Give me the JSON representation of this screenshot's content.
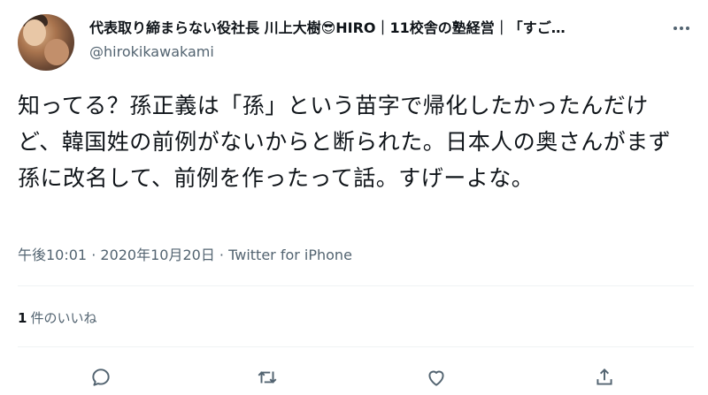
{
  "author": {
    "display_name": "代表取り締まらない役社長 川上大樹😎HIRO｜11校舎の塾経営｜「すご…",
    "handle": "@hirokikawakami"
  },
  "tweet": {
    "text": "知ってる？孫正義は「孫」という苗字で帰化したかったんだけど、韓国姓の前例がないからと断られた。日本人の奥さんがまず孫に改名して、前例を作ったって話。すげーよな。",
    "time": "午後10:01",
    "sep": " · ",
    "date": "2020年10月20日",
    "source": "Twitter for iPhone"
  },
  "stats": {
    "like_count": "1",
    "like_label": "件のいいね"
  },
  "icons": {
    "more": "more-icon",
    "reply": "reply-icon",
    "retweet": "retweet-icon",
    "like": "like-icon",
    "share": "share-icon"
  },
  "colors": {
    "text": "#0f1419",
    "secondary": "#536471",
    "divider": "#eff3f4"
  }
}
